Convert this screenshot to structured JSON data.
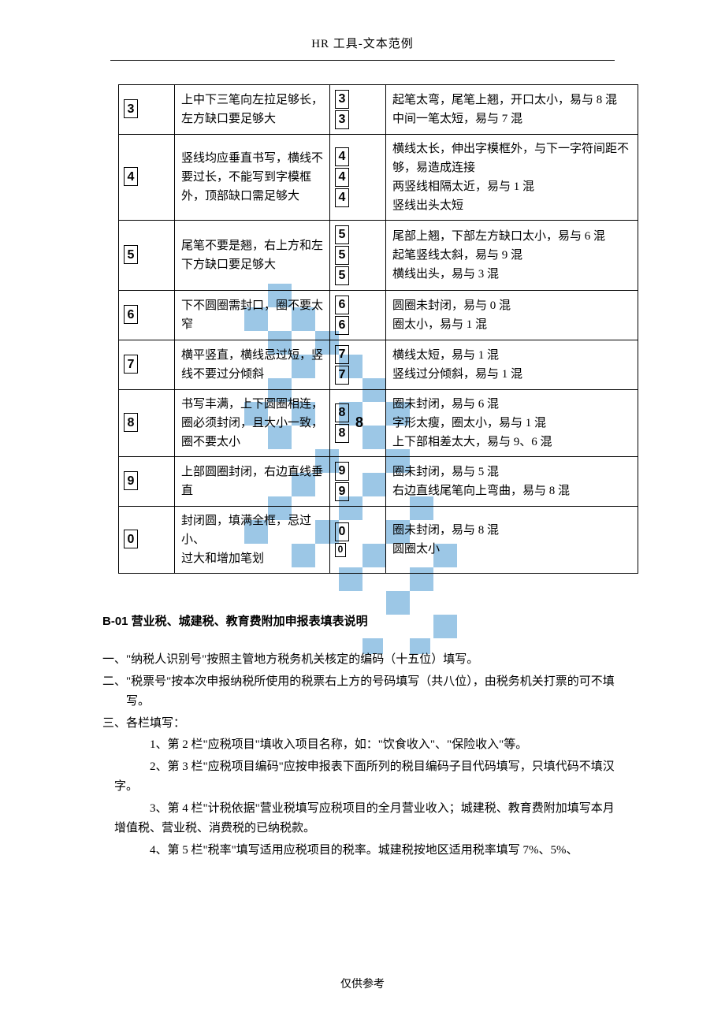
{
  "header": "HR 工具-文本范例",
  "footer": "仅供参考",
  "rows": [
    {
      "sample": "3",
      "rule": "上中下三笔向左拉足够长，左方缺口要足够大",
      "wrong": [
        "3",
        "3"
      ],
      "wrong_desc": "起笔太弯，尾笔上翘，开口太小，易与 8 混\n中间一笔太短，易与 7 混"
    },
    {
      "sample": "4",
      "rule": "竖线均应垂直书写，横线不要过长，不能写到字模框外，顶部缺口需足够大",
      "wrong": [
        "4",
        "4",
        "4"
      ],
      "wrong_desc": "横线太长，伸出字模框外，与下一字符间距不够，易造成连接\n两竖线相隔太近，易与 1 混\n竖线出头太短"
    },
    {
      "sample": "5",
      "rule": "尾笔不要是翘，右上方和左下方缺口要足够大",
      "wrong": [
        "5",
        "5",
        "5"
      ],
      "wrong_desc": "尾部上翘，下部左方缺口太小，易与 6 混\n起笔竖线太斜，易与 9 混\n横线出头，易与 3 混"
    },
    {
      "sample": "6",
      "rule": "下不圆圈需封口，圈不要太窄",
      "wrong": [
        "6",
        "6"
      ],
      "wrong_desc": "圆圈未封闭，易与 0 混\n圈太小，易与 1 混"
    },
    {
      "sample": "7",
      "rule": "横平竖直，横线忌过短，竖线不要过分倾斜",
      "wrong": [
        "7",
        "7"
      ],
      "wrong_desc": "横线太短，易与 1 混\n竖线过分倾斜，易与 1 混"
    },
    {
      "sample": "8",
      "rule": "书写丰满，上下圆圈相连，\n圈必须封闭，且大小一致，\n圈不要太小",
      "wrong": [
        "8",
        "8",
        "8"
      ],
      "wrong_desc": "圈未封闭，易与 6 混\n字形太瘦，圈太小，易与 1 混\n上下部相差太大，易与 9、6 混"
    },
    {
      "sample": "9",
      "rule": "上部圆圈封闭，右边直线垂直",
      "wrong": [
        "9",
        "9"
      ],
      "wrong_desc": "圈未封闭，易与 5 混\n右边直线尾笔向上弯曲，易与 8 混"
    },
    {
      "sample": "0",
      "rule": "封闭圆，填满全框，忌过小、\n过大和增加笔划",
      "wrong": [
        "0",
        "0"
      ],
      "wrong_desc": "圈未封闭，易与 8 混\n圆圈太小"
    }
  ],
  "section_title": "B-01 营业税、城建税、教育费附加申报表填表说明",
  "body": {
    "p1": "一、\"纳税人识别号\"按照主管地方税务机关核定的编码（十五位）填写。",
    "p2": "二、\"税票号\"按本次申报纳税所使用的税票右上方的号码填写（共八位），由税务机关打票的可不填写。",
    "p3": "三、各栏填写：",
    "p3_1": "1、第 2 栏\"应税项目\"填收入项目名称，如：\"饮食收入\"、\"保险收入\"等。",
    "p3_2": "2、第 3 栏\"应税项目编码\"应按申报表下面所列的税目编码子目代码填写，只填代码不填汉字。",
    "p3_3": "3、第 4 栏\"计税依据\"营业税填写应税项目的全月营业收入；城建税、教育费附加填写本月增值税、营业税、消费税的已纳税款。",
    "p3_4": "4、第 5 栏\"税率\"填写适用应税项目的税率。城建税按地区适用税率填写 7%、5%、"
  }
}
